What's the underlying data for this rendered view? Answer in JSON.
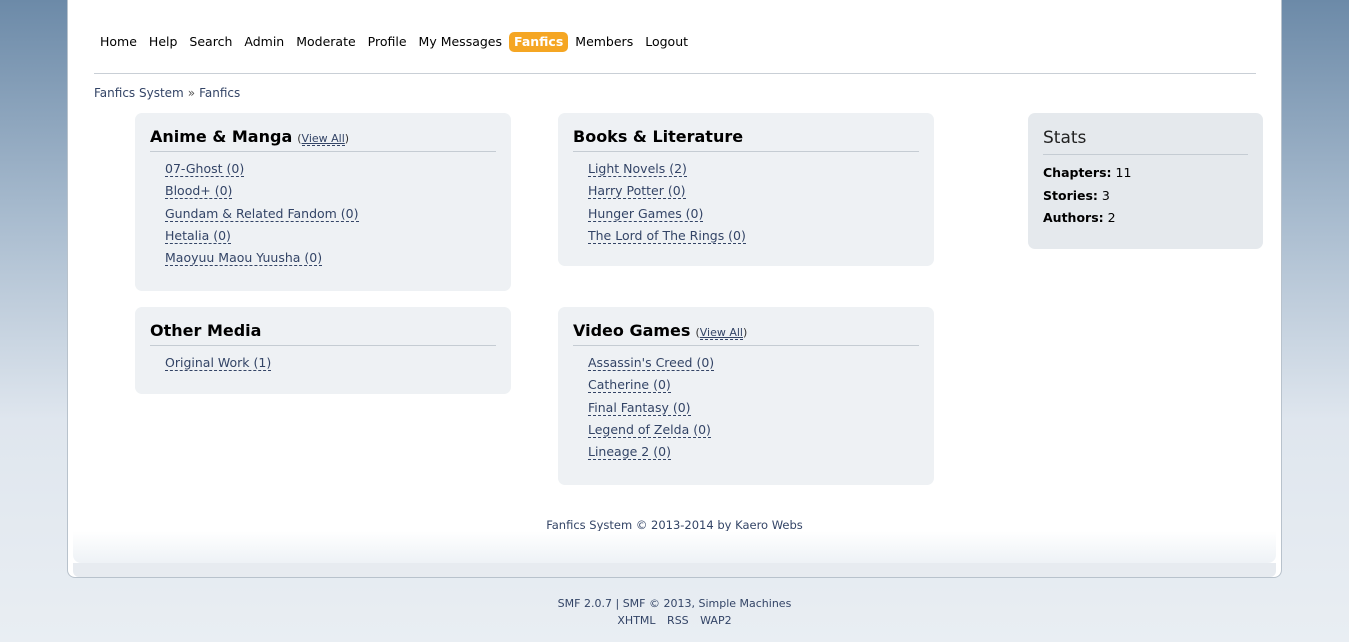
{
  "menu": {
    "items": [
      "Home",
      "Help",
      "Search",
      "Admin",
      "Moderate",
      "Profile",
      "My Messages",
      "Fanfics",
      "Members",
      "Logout"
    ],
    "active": "Fanfics",
    "active_color": "#f5a623"
  },
  "breadcrumb": {
    "root": "Fanfics System",
    "separator": "»",
    "current": "Fanfics"
  },
  "categories": {
    "anime": {
      "title": "Anime & Manga",
      "view_all": "View All",
      "items": [
        "07-Ghost (0)",
        "Blood+ (0)",
        "Gundam & Related Fandom (0)",
        "Hetalia (0)",
        "Maoyuu Maou Yuusha (0)"
      ]
    },
    "books": {
      "title": "Books & Literature",
      "items": [
        "Light Novels (2)",
        "Harry Potter (0)",
        "Hunger Games (0)",
        "The Lord of The Rings (0)"
      ]
    },
    "other": {
      "title": "Other Media",
      "items": [
        "Original Work (1)"
      ]
    },
    "games": {
      "title": "Video Games",
      "view_all": "View All",
      "items": [
        "Assassin's Creed (0)",
        "Catherine (0)",
        "Final Fantasy (0)",
        "Legend of Zelda (0)",
        "Lineage 2 (0)"
      ]
    }
  },
  "stats": {
    "title": "Stats",
    "chapters_label": "Chapters:",
    "chapters": "11",
    "stories_label": "Stories:",
    "stories": "3",
    "authors_label": "Authors:",
    "authors": "2"
  },
  "credit": "Fanfics System © 2013-2014 by Kaero Webs",
  "footer": {
    "smf_version": "SMF 2.0.7",
    "separator": "|",
    "smf_copyright": "SMF © 2013, Simple Machines",
    "links": [
      "XHTML",
      "RSS",
      "WAP2"
    ]
  }
}
